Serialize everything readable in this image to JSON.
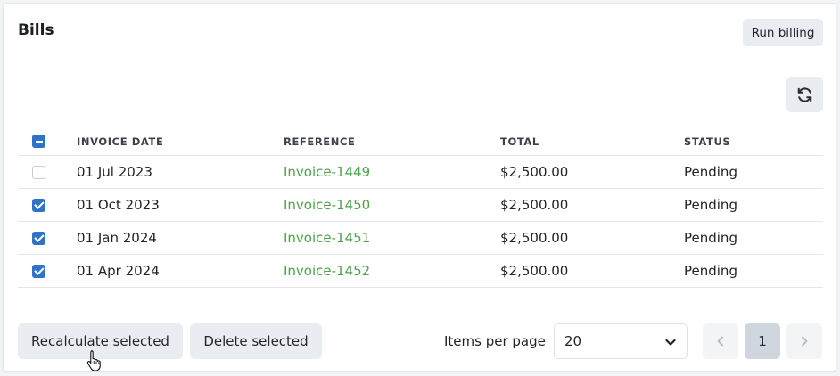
{
  "header": {
    "title": "Bills",
    "run_billing_label": "Run billing"
  },
  "toolbar": {
    "refresh_icon": "refresh-icon"
  },
  "table": {
    "columns": [
      "INVOICE DATE",
      "REFERENCE",
      "TOTAL",
      "STATUS"
    ],
    "select_all_state": "indeterminate",
    "rows": [
      {
        "selected": false,
        "invoice_date": "01 Jul 2023",
        "reference": "Invoice-1449",
        "total": "$2,500.00",
        "status": "Pending"
      },
      {
        "selected": true,
        "invoice_date": "01 Oct 2023",
        "reference": "Invoice-1450",
        "total": "$2,500.00",
        "status": "Pending"
      },
      {
        "selected": true,
        "invoice_date": "01 Jan 2024",
        "reference": "Invoice-1451",
        "total": "$2,500.00",
        "status": "Pending"
      },
      {
        "selected": true,
        "invoice_date": "01 Apr 2024",
        "reference": "Invoice-1452",
        "total": "$2,500.00",
        "status": "Pending"
      }
    ]
  },
  "footer": {
    "recalculate_label": "Recalculate selected",
    "delete_label": "Delete selected",
    "items_per_page_label": "Items per page",
    "items_per_page_value": "20",
    "current_page": "1"
  },
  "colors": {
    "link": "#4ea24a",
    "checkbox": "#2f73c9",
    "button_bg": "#e9edf1",
    "active_page_bg": "#cfd6de"
  }
}
